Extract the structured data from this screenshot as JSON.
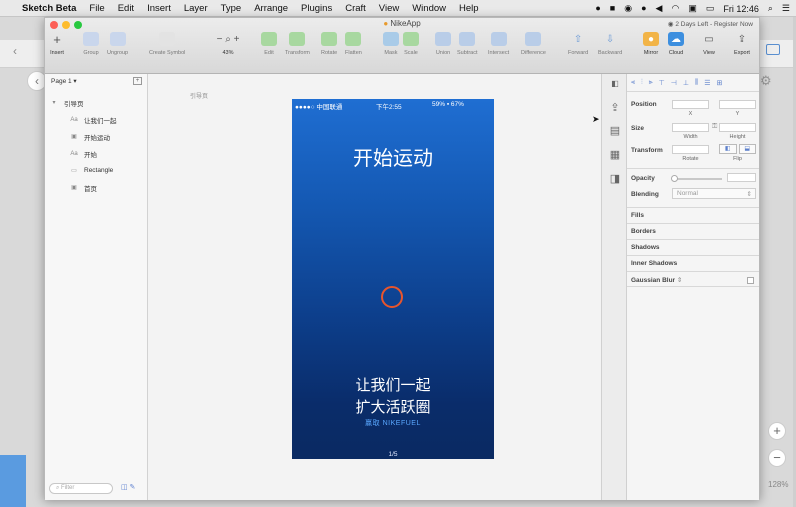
{
  "menubar": {
    "app": "Sketch Beta",
    "items": [
      "File",
      "Edit",
      "Insert",
      "Layer",
      "Type",
      "Arrange",
      "Plugins",
      "Craft",
      "View",
      "Window",
      "Help"
    ],
    "clock": "Fri 12:46"
  },
  "window": {
    "title": "NikeApp",
    "trial_notice": "2 Days Left - Register Now",
    "zoom": "43%",
    "toolbar": [
      {
        "label": "Insert",
        "icon": "plus-icon"
      },
      {
        "label": "Group",
        "icon": "group-icon"
      },
      {
        "label": "Ungroup",
        "icon": "ungroup-icon"
      },
      {
        "label": "Create Symbol",
        "icon": "symbol-icon"
      },
      {
        "label": "Edit",
        "icon": "edit-icon"
      },
      {
        "label": "Transform",
        "icon": "transform-icon"
      },
      {
        "label": "Rotate",
        "icon": "rotate-icon"
      },
      {
        "label": "Flatten",
        "icon": "flatten-icon"
      },
      {
        "label": "Mask",
        "icon": "mask-icon"
      },
      {
        "label": "Scale",
        "icon": "scale-icon"
      },
      {
        "label": "Union",
        "icon": "union-icon"
      },
      {
        "label": "Subtract",
        "icon": "subtract-icon"
      },
      {
        "label": "Intersect",
        "icon": "intersect-icon"
      },
      {
        "label": "Difference",
        "icon": "difference-icon"
      },
      {
        "label": "Forward",
        "icon": "forward-icon"
      },
      {
        "label": "Backward",
        "icon": "backward-icon"
      },
      {
        "label": "Mirror",
        "icon": "mirror-icon"
      },
      {
        "label": "Cloud",
        "icon": "cloud-icon"
      },
      {
        "label": "View",
        "icon": "view-icon"
      },
      {
        "label": "Export",
        "icon": "export-icon"
      }
    ]
  },
  "layers": {
    "page": "Page 1",
    "items": [
      {
        "name": "引导页",
        "type": "artboard"
      },
      {
        "name": "让我们一起",
        "type": "text"
      },
      {
        "name": "开始运动",
        "type": "image"
      },
      {
        "name": "开始",
        "type": "text"
      },
      {
        "name": "Rectangle",
        "type": "shape"
      },
      {
        "name": "首页",
        "type": "image"
      }
    ],
    "filter_placeholder": "Filter"
  },
  "artboard": {
    "label": "引导页",
    "status_left": "●●●●○ 中国联通",
    "status_time": "下午2:55",
    "status_right": "59% ▪ 67%",
    "title": "开始运动",
    "line1": "让我们一起",
    "line2": "扩大活跃圈",
    "line3_a": "赢取",
    "line3_b": "NIKEFUEL",
    "page_indicator": "1/5"
  },
  "inspector": {
    "position": "Position",
    "x": "X",
    "y": "Y",
    "size": "Size",
    "width": "Width",
    "height": "Height",
    "transform": "Transform",
    "rotate": "Rotate",
    "flip": "Flip",
    "opacity": "Opacity",
    "blending": "Blending",
    "blending_value": "Normal",
    "sections": [
      "Fills",
      "Borders",
      "Shadows",
      "Inner Shadows",
      "Gaussian Blur"
    ]
  },
  "background_zoom": "128%"
}
